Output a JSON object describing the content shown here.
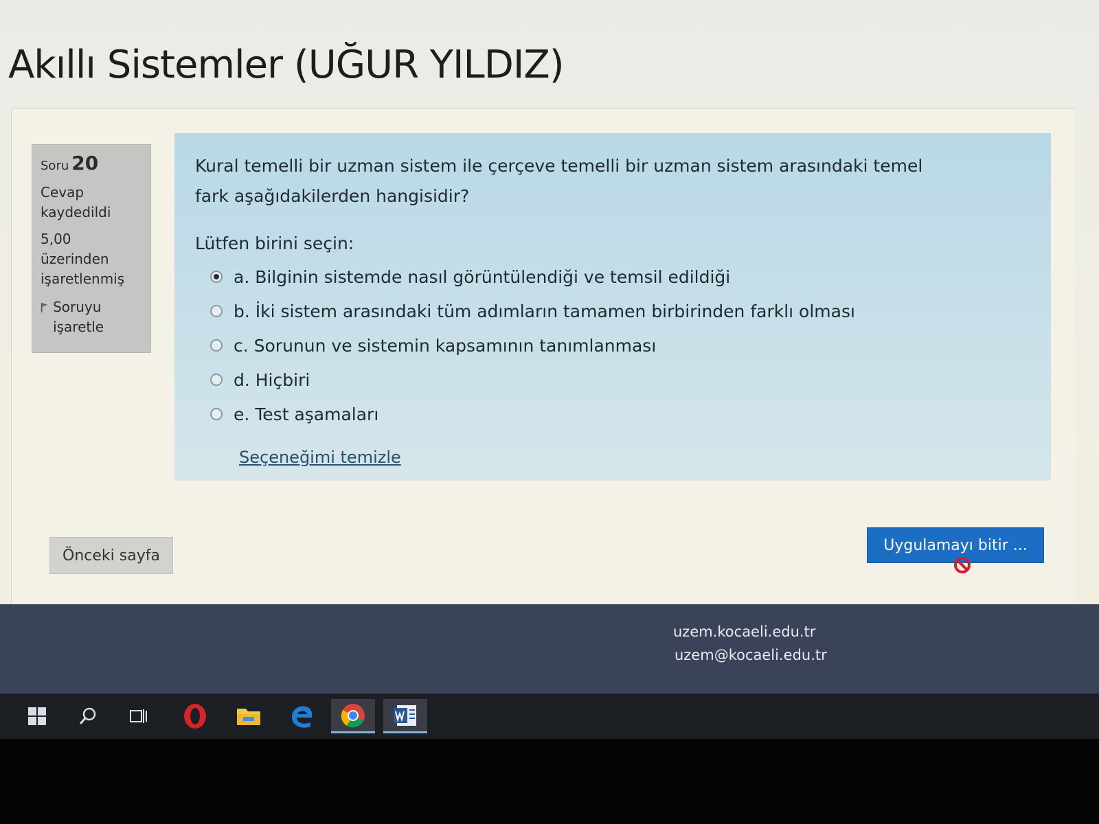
{
  "page": {
    "title": "Akıllı Sistemler (UĞUR YILDIZ)"
  },
  "question_info": {
    "label": "Soru",
    "number": "20",
    "status": "Cevap kaydedildi",
    "mark": "5,00 üzerinden işaretlenmiş",
    "flag_label": "Soruyu işaretle"
  },
  "question": {
    "text": "Kural temelli bir uzman sistem ile çerçeve temelli bir uzman sistem arasındaki temel fark aşağıdakilerden hangisidir?",
    "prompt": "Lütfen birini seçin:",
    "answers": [
      {
        "label": "a. Bilginin sistemde nasıl görüntülendiği ve temsil edildiği",
        "selected": true
      },
      {
        "label": "b. İki sistem arasındaki tüm adımların tamamen birbirinden farklı olması",
        "selected": false
      },
      {
        "label": "c. Sorunun ve sistemin kapsamının tanımlanması",
        "selected": false
      },
      {
        "label": "d. Hiçbiri",
        "selected": false
      },
      {
        "label": "e. Test aşamaları",
        "selected": false
      }
    ],
    "clear_label": "Seçeneğimi temizle"
  },
  "navigation": {
    "prev_label": "Önceki sayfa",
    "finish_label": "Uygulamayı bitir ..."
  },
  "footer": {
    "website": "uzem.kocaeli.edu.tr",
    "email": "uzem@kocaeli.edu.tr"
  },
  "taskbar": {
    "items": [
      "windows-start-icon",
      "search-icon",
      "task-view-icon",
      "opera-icon",
      "file-explorer-icon",
      "edge-icon",
      "chrome-icon",
      "word-icon"
    ]
  },
  "colors": {
    "question_bg": "#c9e0e9",
    "finish_button": "#1b6ec4",
    "footer_bg": "#3a4358"
  }
}
